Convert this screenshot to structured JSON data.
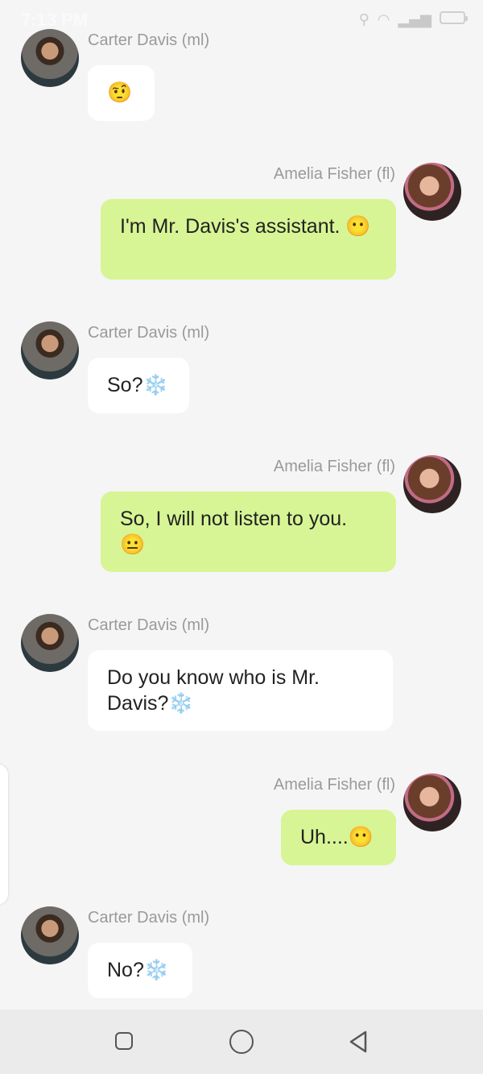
{
  "status_bar": {
    "time": "7:13 PM",
    "icons": [
      "mute-icon",
      "wifi-icon",
      "signal-icon",
      "data-speed-icon",
      "battery-icon"
    ]
  },
  "messages": [
    {
      "sender": "Carter Davis (ml)",
      "side": "left",
      "text": "🤨"
    },
    {
      "sender": "Amelia Fisher (fl)",
      "side": "right",
      "text": "I'm Mr. Davis's assistant. 😶"
    },
    {
      "sender": "Carter Davis (ml)",
      "side": "left",
      "text": "So?❄️"
    },
    {
      "sender": "Amelia Fisher (fl)",
      "side": "right",
      "text": "So, I will not listen to you. 😐"
    },
    {
      "sender": "Carter Davis (ml)",
      "side": "left",
      "text": "Do you know who is Mr. Davis?❄️"
    },
    {
      "sender": "Amelia Fisher (fl)",
      "side": "right",
      "text": "Uh....😶"
    },
    {
      "sender": "Carter Davis (ml)",
      "side": "left",
      "text": "No?❄️"
    }
  ],
  "navbar": {
    "buttons": [
      "recent-apps-icon",
      "home-icon",
      "back-icon"
    ]
  },
  "colors": {
    "background": "#f5f5f5",
    "incoming_bubble": "#ffffff",
    "outgoing_bubble": "#d7f595",
    "name_text": "#9a9a9a"
  }
}
